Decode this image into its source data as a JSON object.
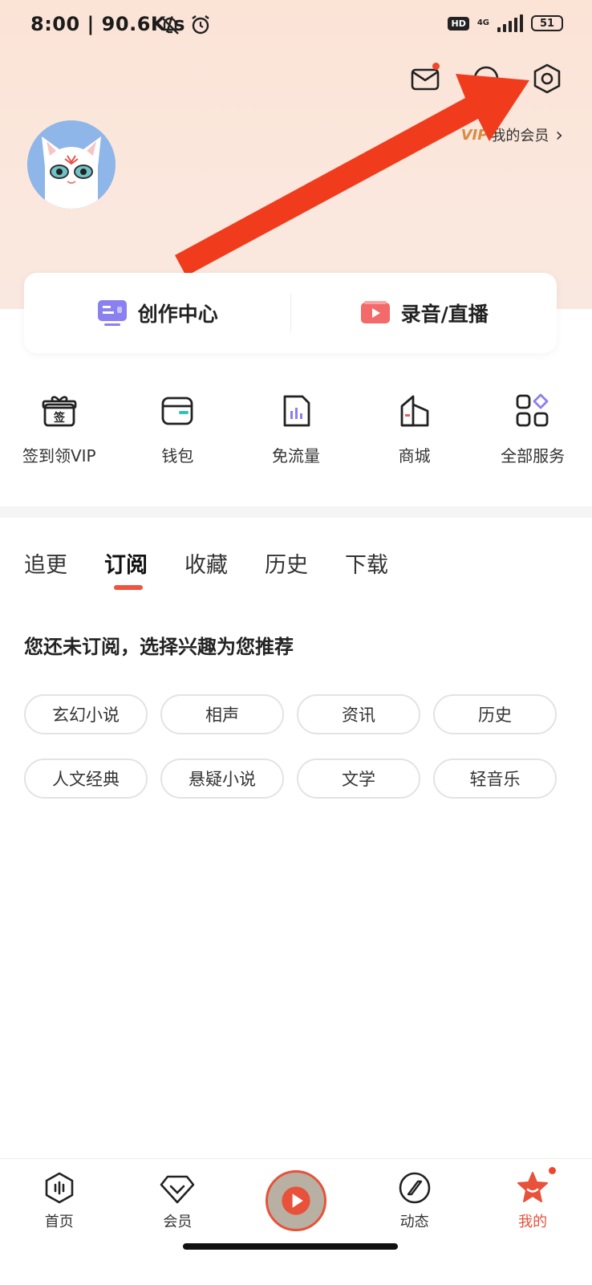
{
  "status_bar": {
    "time": "8:00 | 90.6K/s",
    "hd": "HD",
    "network": "4G",
    "battery": "51"
  },
  "header": {
    "vip_badge": "VIP",
    "my_membership": "我的会员",
    "chevron": "›"
  },
  "quick_card": {
    "creation_center": "创作中心",
    "record_live": "录音/直播"
  },
  "services": [
    {
      "label": "签到领VIP",
      "icon": "gift-sign-icon"
    },
    {
      "label": "钱包",
      "icon": "wallet-icon"
    },
    {
      "label": "免流量",
      "icon": "sim-card-icon"
    },
    {
      "label": "商城",
      "icon": "shop-icon"
    },
    {
      "label": "全部服务",
      "icon": "grid-apps-icon"
    }
  ],
  "gift_glyph": "签",
  "tabs": [
    {
      "label": "追更",
      "active": false
    },
    {
      "label": "订阅",
      "active": true
    },
    {
      "label": "收藏",
      "active": false
    },
    {
      "label": "历史",
      "active": false
    },
    {
      "label": "下载",
      "active": false
    }
  ],
  "recommend_title": "您还未订阅，选择兴趣为您推荐",
  "chips": [
    "玄幻小说",
    "相声",
    "资讯",
    "历史",
    "人文经典",
    "悬疑小说",
    "文学",
    "轻音乐"
  ],
  "bottom_nav": [
    {
      "label": "首页",
      "active": false
    },
    {
      "label": "会员",
      "active": false
    },
    {
      "label": "",
      "active": false
    },
    {
      "label": "动态",
      "active": false
    },
    {
      "label": "我的",
      "active": true
    }
  ],
  "colors": {
    "accent": "#e8513a",
    "header_bg": "#fbe3d6",
    "vip": "#d98b45",
    "arrow": "#f03c1c"
  }
}
